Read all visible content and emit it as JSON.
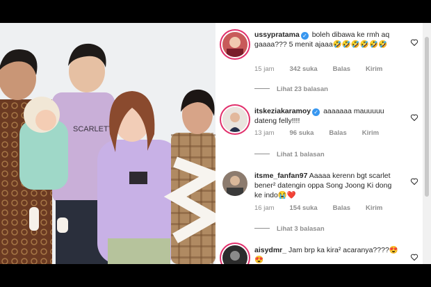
{
  "comments": [
    {
      "username": "ussypratama",
      "verified": true,
      "text": "boleh dibawa ke rmh aq gaaaa??? 5 menit ajaaa🤣🤣🤣🤣🤣🤣",
      "time": "15 jam",
      "likes": "342 suka",
      "reply_label": "Balas",
      "send_label": "Kirim",
      "view_replies": "Lihat 23 balasan"
    },
    {
      "username": "itskeziakaramoy",
      "verified": true,
      "text": "aaaaaaa mauuuuu dateng felly!!!!",
      "time": "13 jam",
      "likes": "96 suka",
      "reply_label": "Balas",
      "send_label": "Kirim",
      "view_replies": "Lihat 1 balasan"
    },
    {
      "username": "itsme_fanfan97",
      "verified": false,
      "text": "Aaaaa kerenn bgt scarlet bener² datengin oppa Song Joong Ki dong ke indo😭❤️",
      "time": "16 jam",
      "likes": "154 suka",
      "reply_label": "Balas",
      "send_label": "Kirim",
      "view_replies": "Lihat 3 balasan"
    },
    {
      "username": "aisydmr_",
      "verified": false,
      "text": "Jam brp ka kira² acaranya????😍😍"
    }
  ],
  "shirt_text": "SCARLETT",
  "colors": {
    "verified": "#3897f0",
    "meta": "#8e8e8e",
    "text": "#262626"
  }
}
